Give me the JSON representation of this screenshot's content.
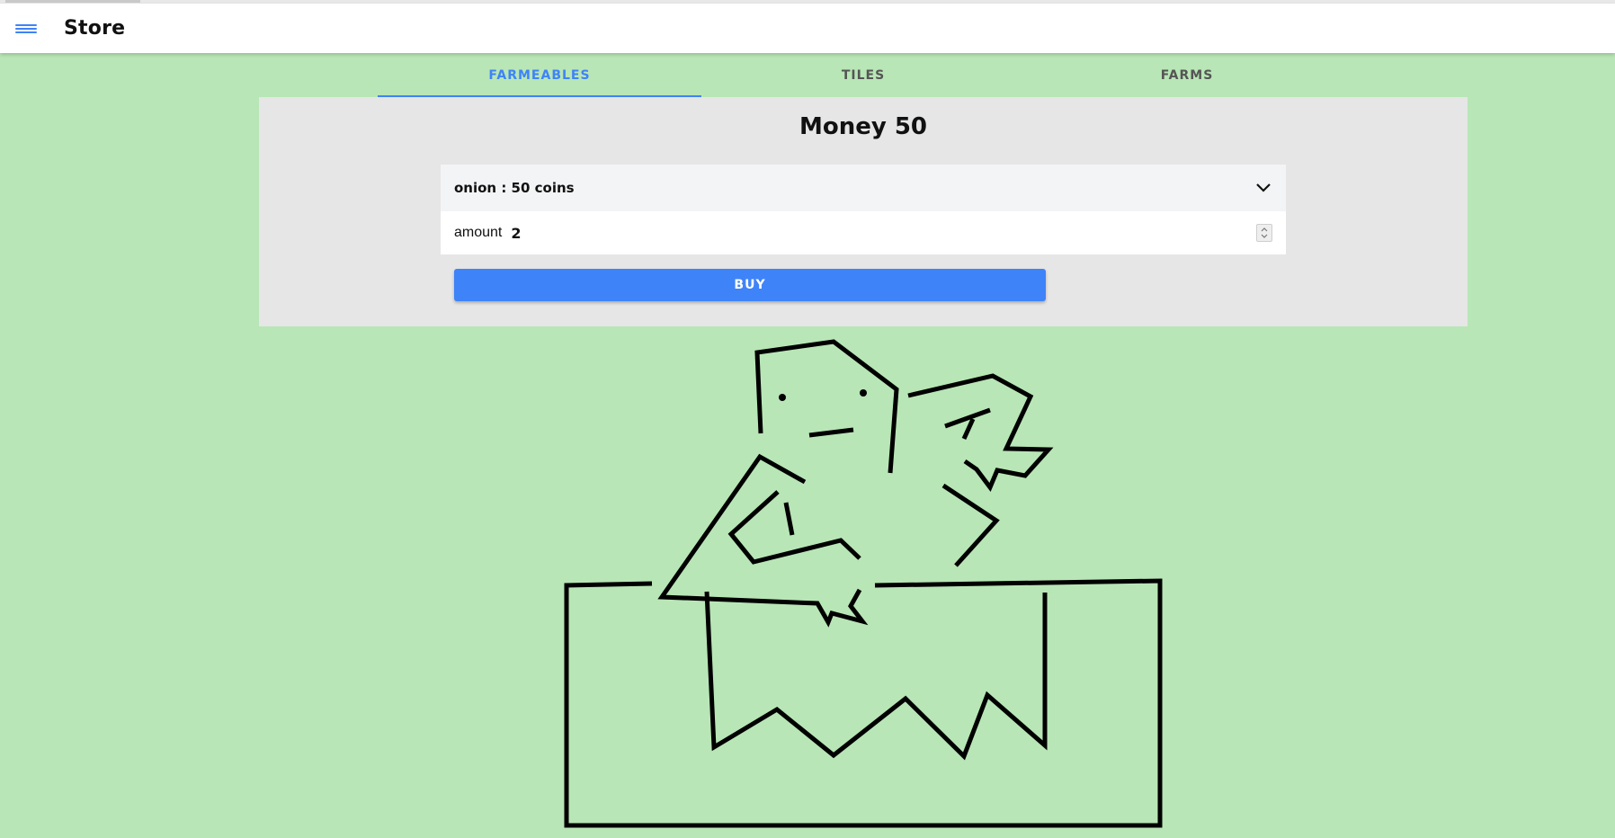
{
  "app": {
    "title": "Store"
  },
  "tabs": [
    {
      "label": "FARMEABLES",
      "active": true
    },
    {
      "label": "TILES",
      "active": false
    },
    {
      "label": "FARMS",
      "active": false
    }
  ],
  "store": {
    "money_label": "Money",
    "money_value": "50",
    "selected_item": "onion : 50 coins",
    "amount_label": "amount",
    "amount_value": "2",
    "buy_label": "BUY"
  },
  "colors": {
    "background": "#b8e6b6",
    "accent": "#3f83f8",
    "panel": "#e6e6e6"
  },
  "icons": {
    "menu": "hamburger-menu-icon",
    "dropdown": "chevron-down-icon",
    "spinner": "number-spinner-icon"
  }
}
